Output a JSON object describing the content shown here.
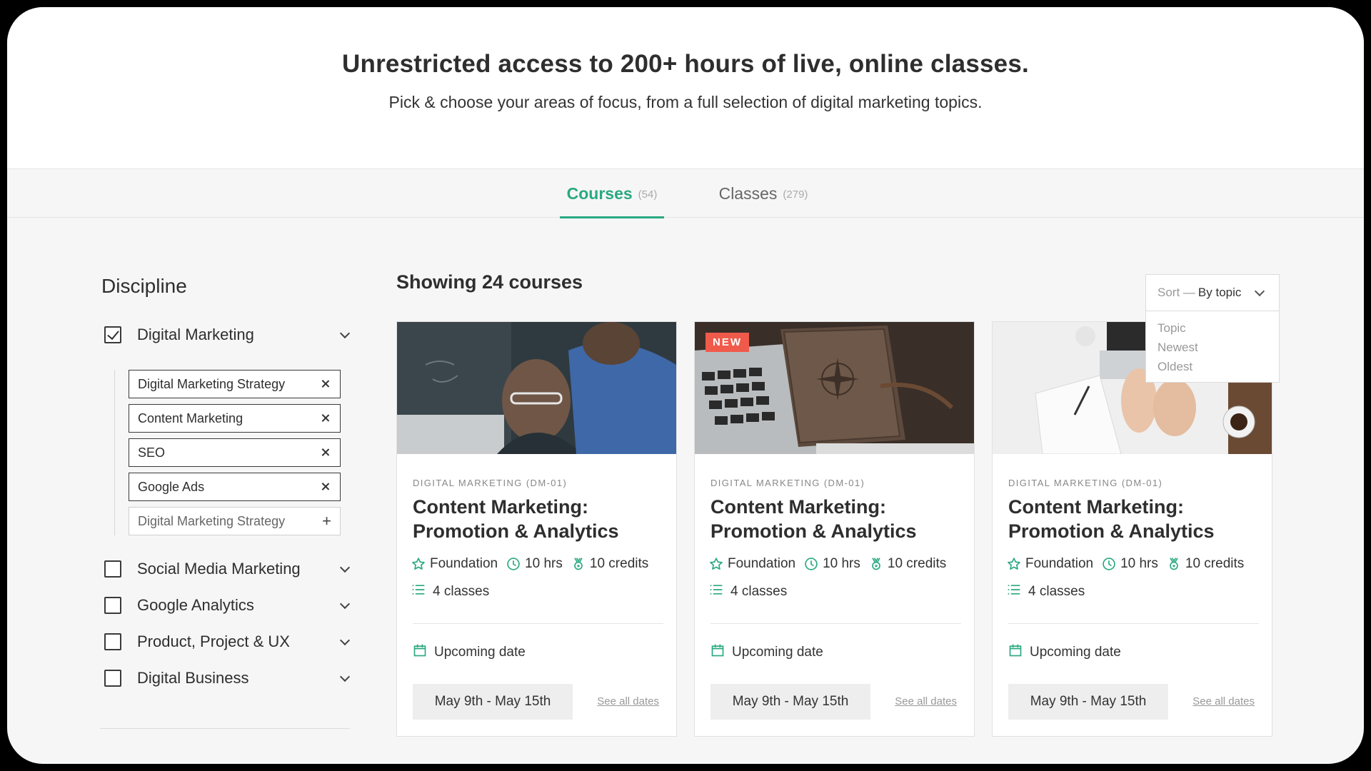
{
  "hero": {
    "title": "Unrestricted access to 200+ hours of live, online classes.",
    "subtitle": "Pick & choose your areas of focus, from a full selection of digital marketing topics."
  },
  "tabs": [
    {
      "label": "Courses",
      "count": "(54)",
      "active": true
    },
    {
      "label": "Classes",
      "count": "(279)",
      "active": false
    }
  ],
  "sidebar": {
    "title": "Discipline",
    "disciplines": [
      {
        "label": "Digital Marketing",
        "checked": true
      },
      {
        "label": "Social Media Marketing",
        "checked": false
      },
      {
        "label": "Google Analytics",
        "checked": false
      },
      {
        "label": "Product, Project & UX",
        "checked": false
      },
      {
        "label": "Digital Business",
        "checked": false
      }
    ],
    "tags": [
      {
        "label": "Digital Marketing Strategy"
      },
      {
        "label": "Content Marketing"
      },
      {
        "label": "SEO"
      },
      {
        "label": "Google Ads"
      }
    ],
    "add_tag": {
      "placeholder": "Digital Marketing Strategy",
      "symbol": "+"
    }
  },
  "main": {
    "showing": "Showing 24 courses",
    "sort": {
      "prefix": "Sort —",
      "value": "By topic",
      "options": [
        "Topic",
        "Newest",
        "Oldest"
      ]
    }
  },
  "cards": [
    {
      "badge": "",
      "category": "DIGITAL MARKETING (DM-01)",
      "title": "Content Marketing: Promotion & Analytics",
      "level": "Foundation",
      "hours": "10 hrs",
      "credits": "10 credits",
      "classes": "4 classes",
      "upcoming_label": "Upcoming date",
      "date": "May 9th - May 15th",
      "see_all": "See all dates"
    },
    {
      "badge": "NEW",
      "category": "DIGITAL MARKETING (DM-01)",
      "title": "Content Marketing: Promotion & Analytics",
      "level": "Foundation",
      "hours": "10 hrs",
      "credits": "10 credits",
      "classes": "4 classes",
      "upcoming_label": "Upcoming date",
      "date": "May 9th - May 15th",
      "see_all": "See all dates"
    },
    {
      "badge": "",
      "category": "DIGITAL MARKETING (DM-01)",
      "title": "Content Marketing: Promotion & Analytics",
      "level": "Foundation",
      "hours": "10 hrs",
      "credits": "10 credits",
      "classes": "4 classes",
      "upcoming_label": "Upcoming date",
      "date": "May 9th - May 15th",
      "see_all": "See all dates"
    }
  ],
  "colors": {
    "accent": "#2aa981",
    "badge": "#f05a4a"
  }
}
